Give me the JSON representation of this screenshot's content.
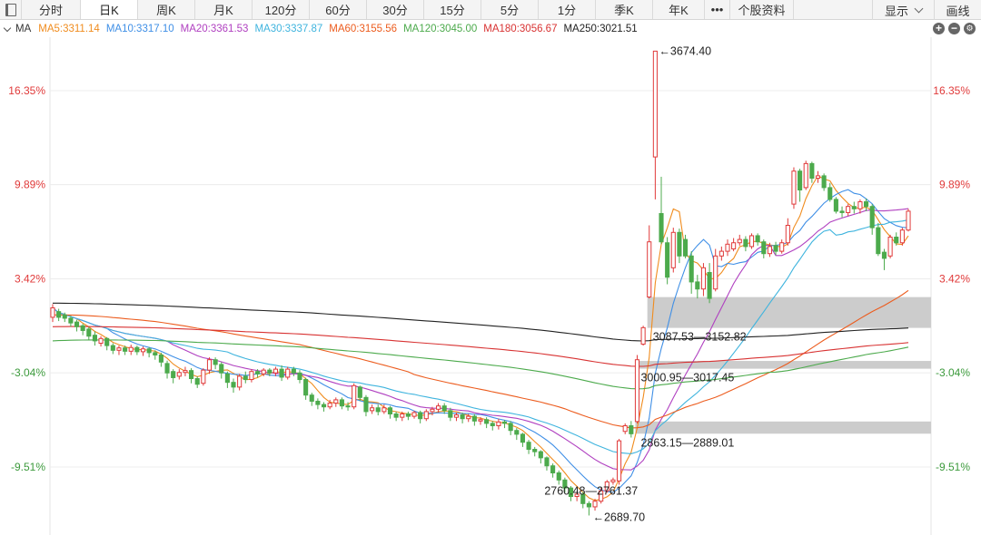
{
  "toolbar": {
    "tabs": [
      {
        "label": "分时",
        "width": 65
      },
      {
        "label": "日K",
        "width": 63,
        "active": true
      },
      {
        "label": "周K",
        "width": 63
      },
      {
        "label": "月K",
        "width": 63
      },
      {
        "label": "120分",
        "width": 63
      },
      {
        "label": "60分",
        "width": 63
      },
      {
        "label": "30分",
        "width": 63
      },
      {
        "label": "15分",
        "width": 63
      },
      {
        "label": "5分",
        "width": 63
      },
      {
        "label": "1分",
        "width": 63
      },
      {
        "label": "季K",
        "width": 63
      },
      {
        "label": "年K",
        "width": 57
      },
      {
        "label": "•••",
        "width": 28
      },
      {
        "label": "个股资料",
        "width": 70
      }
    ],
    "display_label": "显示",
    "draw_label": "画线"
  },
  "ma_legend": {
    "title": "MA",
    "items": [
      {
        "text": "MA5:3311.14",
        "color": "#f08c1e"
      },
      {
        "text": "MA10:3317.10",
        "color": "#3f8fe6"
      },
      {
        "text": "MA20:3361.53",
        "color": "#b040c0"
      },
      {
        "text": "MA30:3337.87",
        "color": "#3fb4de"
      },
      {
        "text": "MA60:3155.56",
        "color": "#ec5c1e"
      },
      {
        "text": "MA120:3045.00",
        "color": "#4caa4c"
      },
      {
        "text": "MA180:3056.67",
        "color": "#d83232"
      },
      {
        "text": "MA250:3021.51",
        "color": "#222222"
      }
    ],
    "zoom_in": "+",
    "zoom_out": "−"
  },
  "chart_data": {
    "type": "candlestick",
    "y_axis_percent_ticks": [
      "16.35%",
      "9.89%",
      "3.42%",
      "-3.04%",
      "-9.51%"
    ],
    "y_axis_percent_values": [
      16.35,
      9.89,
      3.42,
      -3.04,
      -9.51
    ],
    "reference_price": 3086,
    "up_color": "#e03a3a",
    "down_color": "#4caa4c",
    "tick_colors": {
      "positive": "#e03a3a",
      "negative": "#3c9a3c"
    },
    "annotations": [
      {
        "text": "3674.40",
        "price": 3674.4,
        "kind": "high"
      },
      {
        "text": "2689.70",
        "price": 2689.7,
        "kind": "low"
      }
    ],
    "gap_zones": [
      {
        "label": "3087.53—3152.82",
        "low": 3087.53,
        "high": 3152.82
      },
      {
        "label": "3000.95—3017.45",
        "low": 3000.95,
        "high": 3017.45
      },
      {
        "label": "2863.15—2889.01",
        "low": 2863.15,
        "high": 2889.01
      },
      {
        "label": "2760.48—2761.37",
        "low": 2760.48,
        "high": 2761.37
      }
    ],
    "candles": [
      [
        3110,
        3130,
        3100,
        3138
      ],
      [
        3122,
        3110,
        3102,
        3128
      ],
      [
        3115,
        3108,
        3100,
        3120
      ],
      [
        3108,
        3098,
        3090,
        3113
      ],
      [
        3100,
        3090,
        3080,
        3105
      ],
      [
        3092,
        3082,
        3072,
        3096
      ],
      [
        3085,
        3070,
        3062,
        3090
      ],
      [
        3072,
        3060,
        3050,
        3080
      ],
      [
        3055,
        3065,
        3048,
        3070
      ],
      [
        3065,
        3050,
        3040,
        3068
      ],
      [
        3050,
        3040,
        3032,
        3055
      ],
      [
        3040,
        3045,
        3030,
        3050
      ],
      [
        3045,
        3038,
        3030,
        3050
      ],
      [
        3038,
        3046,
        3030,
        3052
      ],
      [
        3046,
        3037,
        3030,
        3050
      ],
      [
        3037,
        3043,
        3028,
        3048
      ],
      [
        3043,
        3035,
        3025,
        3047
      ],
      [
        3035,
        3030,
        3020,
        3040
      ],
      [
        3030,
        3015,
        3005,
        3035
      ],
      [
        3012,
        2992,
        2980,
        3018
      ],
      [
        2995,
        2982,
        2970,
        3000
      ],
      [
        2985,
        2993,
        2978,
        3000
      ],
      [
        2993,
        2997,
        2985,
        3005
      ],
      [
        2997,
        2980,
        2970,
        3002
      ],
      [
        2980,
        2968,
        2960,
        2985
      ],
      [
        2970,
        2998,
        2965,
        3002
      ],
      [
        2998,
        3020,
        2990,
        3025
      ],
      [
        3020,
        3010,
        3000,
        3025
      ],
      [
        3010,
        2992,
        2980,
        3015
      ],
      [
        2990,
        2972,
        2960,
        2995
      ],
      [
        2972,
        2962,
        2950,
        2980
      ],
      [
        2962,
        2985,
        2955,
        2990
      ],
      [
        2985,
        2978,
        2970,
        2995
      ],
      [
        2978,
        2995,
        2972,
        3000
      ],
      [
        2995,
        2990,
        2982,
        3000
      ],
      [
        2990,
        2998,
        2985,
        3002
      ],
      [
        2998,
        2992,
        2985,
        3002
      ],
      [
        2992,
        3000,
        2985,
        3005
      ],
      [
        3000,
        2983,
        2975,
        3008
      ],
      [
        2983,
        3000,
        2978,
        3005
      ],
      [
        3000,
        2992,
        2985,
        3005
      ],
      [
        2992,
        2978,
        2970,
        2998
      ],
      [
        2978,
        2945,
        2935,
        2982
      ],
      [
        2945,
        2932,
        2922,
        2950
      ],
      [
        2932,
        2925,
        2915,
        2938
      ],
      [
        2925,
        2920,
        2910,
        2930
      ],
      [
        2920,
        2928,
        2915,
        2935
      ],
      [
        2928,
        2935,
        2920,
        2940
      ],
      [
        2935,
        2922,
        2915,
        2940
      ],
      [
        2922,
        2920,
        2912,
        2930
      ],
      [
        2920,
        2965,
        2915,
        2970
      ],
      [
        2962,
        2940,
        2932,
        2965
      ],
      [
        2940,
        2910,
        2900,
        2945
      ],
      [
        2912,
        2918,
        2905,
        2925
      ],
      [
        2918,
        2910,
        2902,
        2925
      ],
      [
        2910,
        2918,
        2905,
        2925
      ],
      [
        2918,
        2905,
        2895,
        2922
      ],
      [
        2905,
        2898,
        2890,
        2910
      ],
      [
        2898,
        2905,
        2890,
        2910
      ],
      [
        2905,
        2900,
        2892,
        2910
      ],
      [
        2900,
        2908,
        2895,
        2912
      ],
      [
        2908,
        2895,
        2885,
        2912
      ],
      [
        2895,
        2910,
        2890,
        2915
      ],
      [
        2910,
        2915,
        2902,
        2920
      ],
      [
        2915,
        2922,
        2908,
        2928
      ],
      [
        2922,
        2912,
        2905,
        2928
      ],
      [
        2912,
        2898,
        2890,
        2918
      ],
      [
        2898,
        2903,
        2890,
        2908
      ],
      [
        2903,
        2895,
        2885,
        2908
      ],
      [
        2895,
        2900,
        2888,
        2905
      ],
      [
        2900,
        2890,
        2880,
        2905
      ],
      [
        2890,
        2893,
        2882,
        2898
      ],
      [
        2893,
        2885,
        2875,
        2898
      ],
      [
        2885,
        2880,
        2870,
        2890
      ],
      [
        2880,
        2888,
        2872,
        2895
      ],
      [
        2888,
        2885,
        2875,
        2892
      ],
      [
        2885,
        2870,
        2860,
        2890
      ],
      [
        2870,
        2862,
        2850,
        2875
      ],
      [
        2862,
        2845,
        2835,
        2865
      ],
      [
        2845,
        2830,
        2820,
        2850
      ],
      [
        2830,
        2825,
        2815,
        2835
      ],
      [
        2825,
        2812,
        2800,
        2828
      ],
      [
        2812,
        2795,
        2785,
        2815
      ],
      [
        2795,
        2780,
        2770,
        2800
      ],
      [
        2780,
        2765,
        2755,
        2785
      ],
      [
        2765,
        2748,
        2738,
        2770
      ],
      [
        2748,
        2730,
        2720,
        2752
      ],
      [
        2730,
        2735,
        2720,
        2740
      ],
      [
        2735,
        2715,
        2705,
        2740
      ],
      [
        2715,
        2708,
        2689.7,
        2720
      ],
      [
        2708,
        2720,
        2700,
        2725
      ],
      [
        2720,
        2742,
        2715,
        2748
      ],
      [
        2742,
        2761,
        2738,
        2765
      ],
      [
        2761,
        2765,
        2755,
        2770
      ],
      [
        2763,
        2848,
        2755,
        2852
      ],
      [
        2868,
        2880,
        2862,
        2885
      ],
      [
        2880,
        2863,
        2855,
        2890
      ],
      [
        2889,
        3020,
        2885,
        3030
      ],
      [
        3053,
        3088,
        3050,
        3092
      ],
      [
        3153,
        3270,
        3150,
        3305
      ],
      [
        3450,
        3674.4,
        3360,
        3674.4
      ],
      [
        3330,
        3270,
        3265,
        3408
      ],
      [
        3268,
        3195,
        3180,
        3280
      ],
      [
        3215,
        3290,
        3205,
        3300
      ],
      [
        3290,
        3240,
        3225,
        3298
      ],
      [
        3275,
        3240,
        3235,
        3285
      ],
      [
        3240,
        3185,
        3160,
        3250
      ],
      [
        3185,
        3170,
        3150,
        3200
      ],
      [
        3170,
        3215,
        3155,
        3225
      ],
      [
        3205,
        3150,
        3140,
        3225
      ],
      [
        3170,
        3240,
        3165,
        3255
      ],
      [
        3240,
        3250,
        3230,
        3260
      ],
      [
        3250,
        3265,
        3240,
        3275
      ],
      [
        3255,
        3268,
        3250,
        3278
      ],
      [
        3268,
        3275,
        3262,
        3285
      ],
      [
        3275,
        3260,
        3250,
        3282
      ],
      [
        3260,
        3283,
        3255,
        3288
      ],
      [
        3283,
        3270,
        3262,
        3288
      ],
      [
        3270,
        3245,
        3235,
        3275
      ],
      [
        3245,
        3260,
        3238,
        3268
      ],
      [
        3262,
        3250,
        3242,
        3270
      ],
      [
        3250,
        3268,
        3245,
        3275
      ],
      [
        3268,
        3305,
        3262,
        3320
      ],
      [
        3350,
        3420,
        3340,
        3428
      ],
      [
        3420,
        3380,
        3355,
        3425
      ],
      [
        3385,
        3436,
        3380,
        3442
      ],
      [
        3436,
        3405,
        3395,
        3440
      ],
      [
        3405,
        3410,
        3395,
        3420
      ],
      [
        3410,
        3385,
        3378,
        3415
      ],
      [
        3385,
        3360,
        3355,
        3395
      ],
      [
        3360,
        3335,
        3330,
        3365
      ],
      [
        3335,
        3332,
        3322,
        3345
      ],
      [
        3332,
        3345,
        3325,
        3350
      ],
      [
        3345,
        3340,
        3330,
        3355
      ],
      [
        3340,
        3355,
        3330,
        3360
      ],
      [
        3355,
        3345,
        3335,
        3362
      ],
      [
        3345,
        3300,
        3285,
        3350
      ],
      [
        3300,
        3245,
        3240,
        3310
      ],
      [
        3248,
        3235,
        3210,
        3255
      ],
      [
        3240,
        3280,
        3235,
        3285
      ],
      [
        3280,
        3268,
        3262,
        3290
      ],
      [
        3268,
        3295,
        3262,
        3300
      ],
      [
        3295,
        3335,
        3292,
        3340
      ]
    ]
  }
}
